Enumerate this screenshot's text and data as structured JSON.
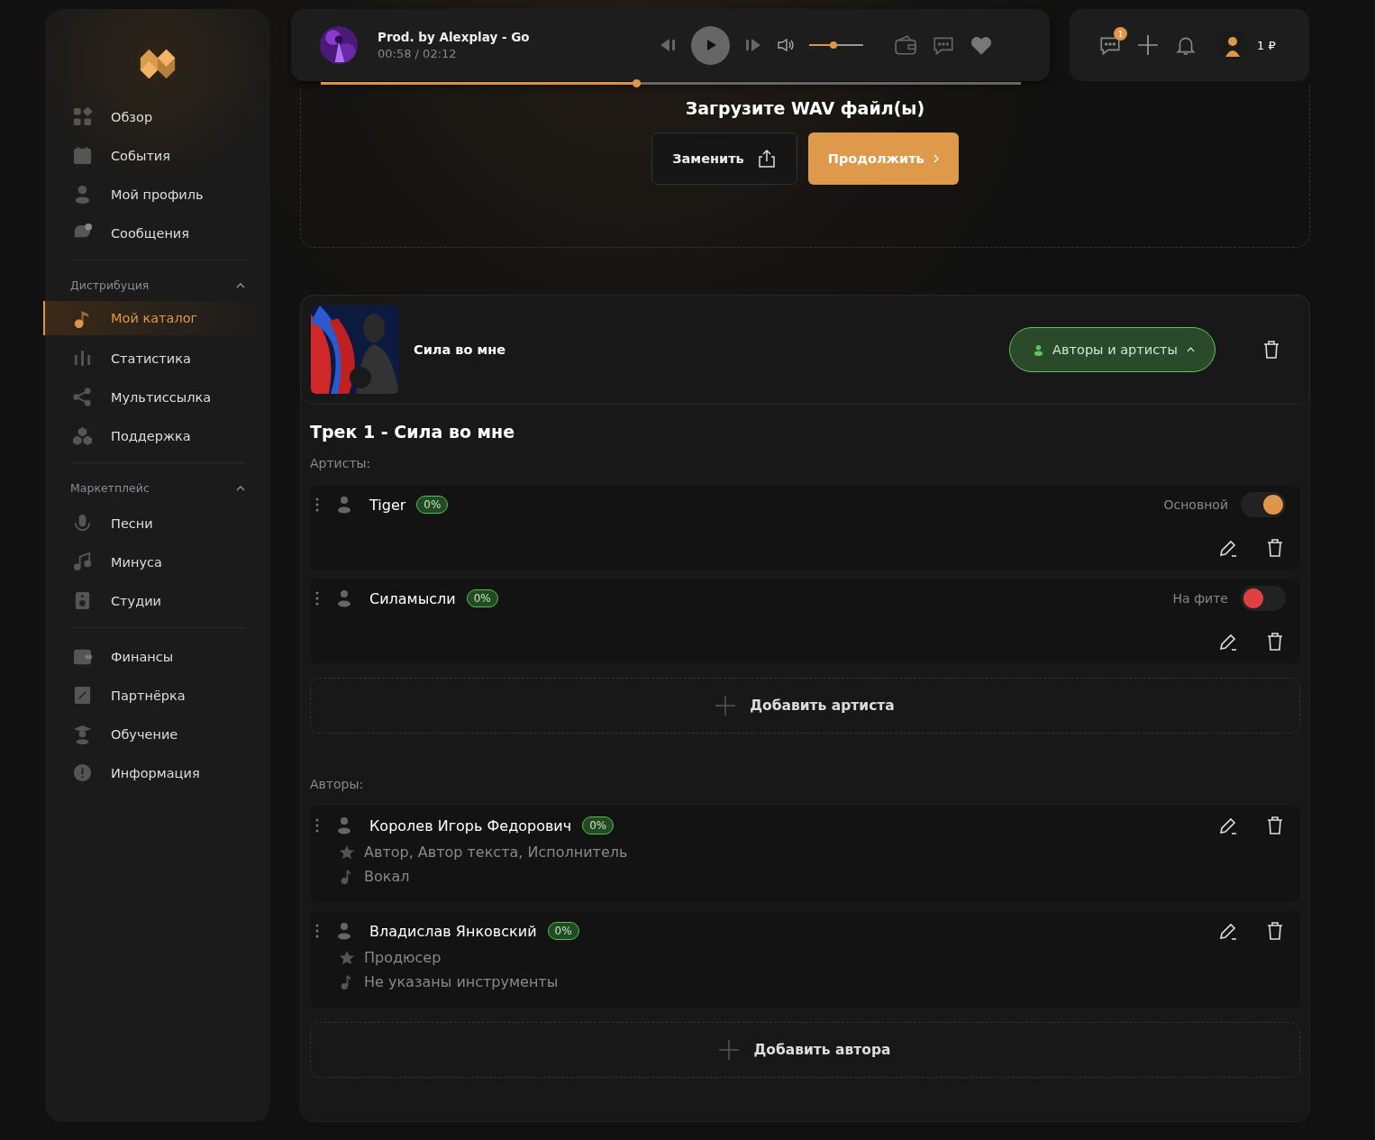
{
  "sidebar": {
    "sections": [
      {
        "items": [
          {
            "label": "Обзор",
            "selected": false
          },
          {
            "label": "События",
            "selected": false
          },
          {
            "label": "Мой профиль",
            "selected": false
          },
          {
            "label": "Сообщения",
            "selected": false
          }
        ]
      },
      {
        "title": "Дистрибуция",
        "expanded": true,
        "items": [
          {
            "label": "Мой каталог",
            "selected": true
          },
          {
            "label": "Статистика",
            "selected": false
          },
          {
            "label": "Мультиссылка",
            "selected": false
          },
          {
            "label": "Поддержка",
            "selected": false
          }
        ]
      },
      {
        "title": "Маркетплейс",
        "expanded": true,
        "items": [
          {
            "label": "Песни",
            "selected": false
          },
          {
            "label": "Минуса",
            "selected": false
          },
          {
            "label": "Студии",
            "selected": false
          }
        ]
      },
      {
        "items": [
          {
            "label": "Финансы",
            "selected": false
          },
          {
            "label": "Партнёрка",
            "selected": false
          },
          {
            "label": "Обучение",
            "selected": false
          },
          {
            "label": "Информация",
            "selected": false
          }
        ]
      }
    ]
  },
  "player": {
    "title": "Prod. by Alexplay - Go",
    "time": "00:58 / 02:12",
    "volume": {
      "level": 0.45
    },
    "progress": {
      "level": 0.45
    },
    "liked": false
  },
  "account": {
    "notifications_badge": "1",
    "balance": "1 ₽"
  },
  "upload": {
    "title": "Загрузите WAV файл(ы)",
    "replace_button": "Заменить",
    "continue_button": "Продолжить"
  },
  "release": {
    "title": "Сила во мне",
    "credits_button": "Авторы и артисты",
    "track_title": "Трек 1 - Сила во мне",
    "artists_label": "Артисты:",
    "artists": [
      {
        "name": "Tiger",
        "share": "0%",
        "role": "Основной",
        "on": true
      },
      {
        "name": "Силамысли",
        "share": "0%",
        "role": "На фите",
        "on": false
      }
    ],
    "add_artist": "Добавить артиста",
    "authors_label": "Авторы:",
    "authors": [
      {
        "name": "Королев Игорь Федорович",
        "share": "0%",
        "roles": "Автор, Автор текста, Исполнитель",
        "instruments": "Вокал"
      },
      {
        "name": "Владислав Янковский",
        "share": "0%",
        "roles": "Продюсер",
        "instruments": "Не указаны инструменты"
      }
    ],
    "add_author": "Добавить автора"
  }
}
